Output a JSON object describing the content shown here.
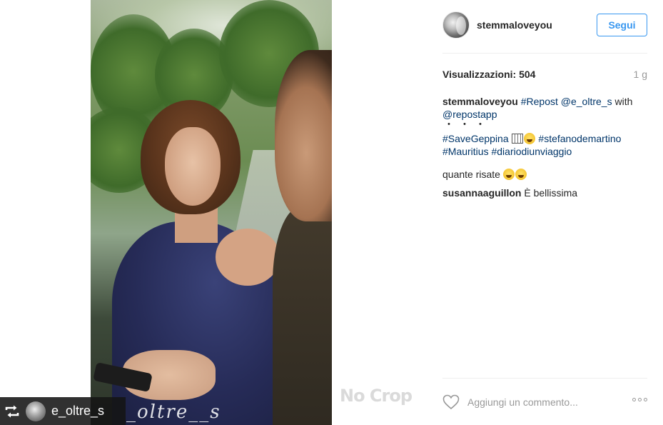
{
  "post": {
    "username": "stemmaloveyou",
    "follow_label": "Segui",
    "views_label": "Visualizzazioni: 504",
    "time_ago": "1 g",
    "caption": {
      "username": "stemmaloveyou",
      "parts": [
        "#Repost",
        "@e_oltre_s",
        "with",
        "@repostapp"
      ],
      "dots": "・・・",
      "hashtags_line1": [
        "#SaveGeppina",
        "#stefanodemartino"
      ],
      "hashtags_line2": [
        "#Mauritius",
        "#diariodiunviaggio"
      ]
    },
    "comments": [
      {
        "username": "",
        "text": "quante risate"
      },
      {
        "username": "susannaaguillon",
        "text": "È bellissima"
      }
    ],
    "add_comment_placeholder": "Aggiungi un commento...",
    "icons": {
      "heart": "heart-icon",
      "more": "more-options-icon",
      "repost": "repost-icon",
      "laugh_emoji": "laughing-tears-emoji"
    }
  },
  "media": {
    "repost_badge_name": "e_oltre_s",
    "watermark_video": "_oltre__s",
    "watermark_nocrop": "No Crop"
  },
  "colors": {
    "link_blue": "#3897f0",
    "hashtag": "#003569",
    "text": "#262626",
    "muted": "#999999"
  }
}
